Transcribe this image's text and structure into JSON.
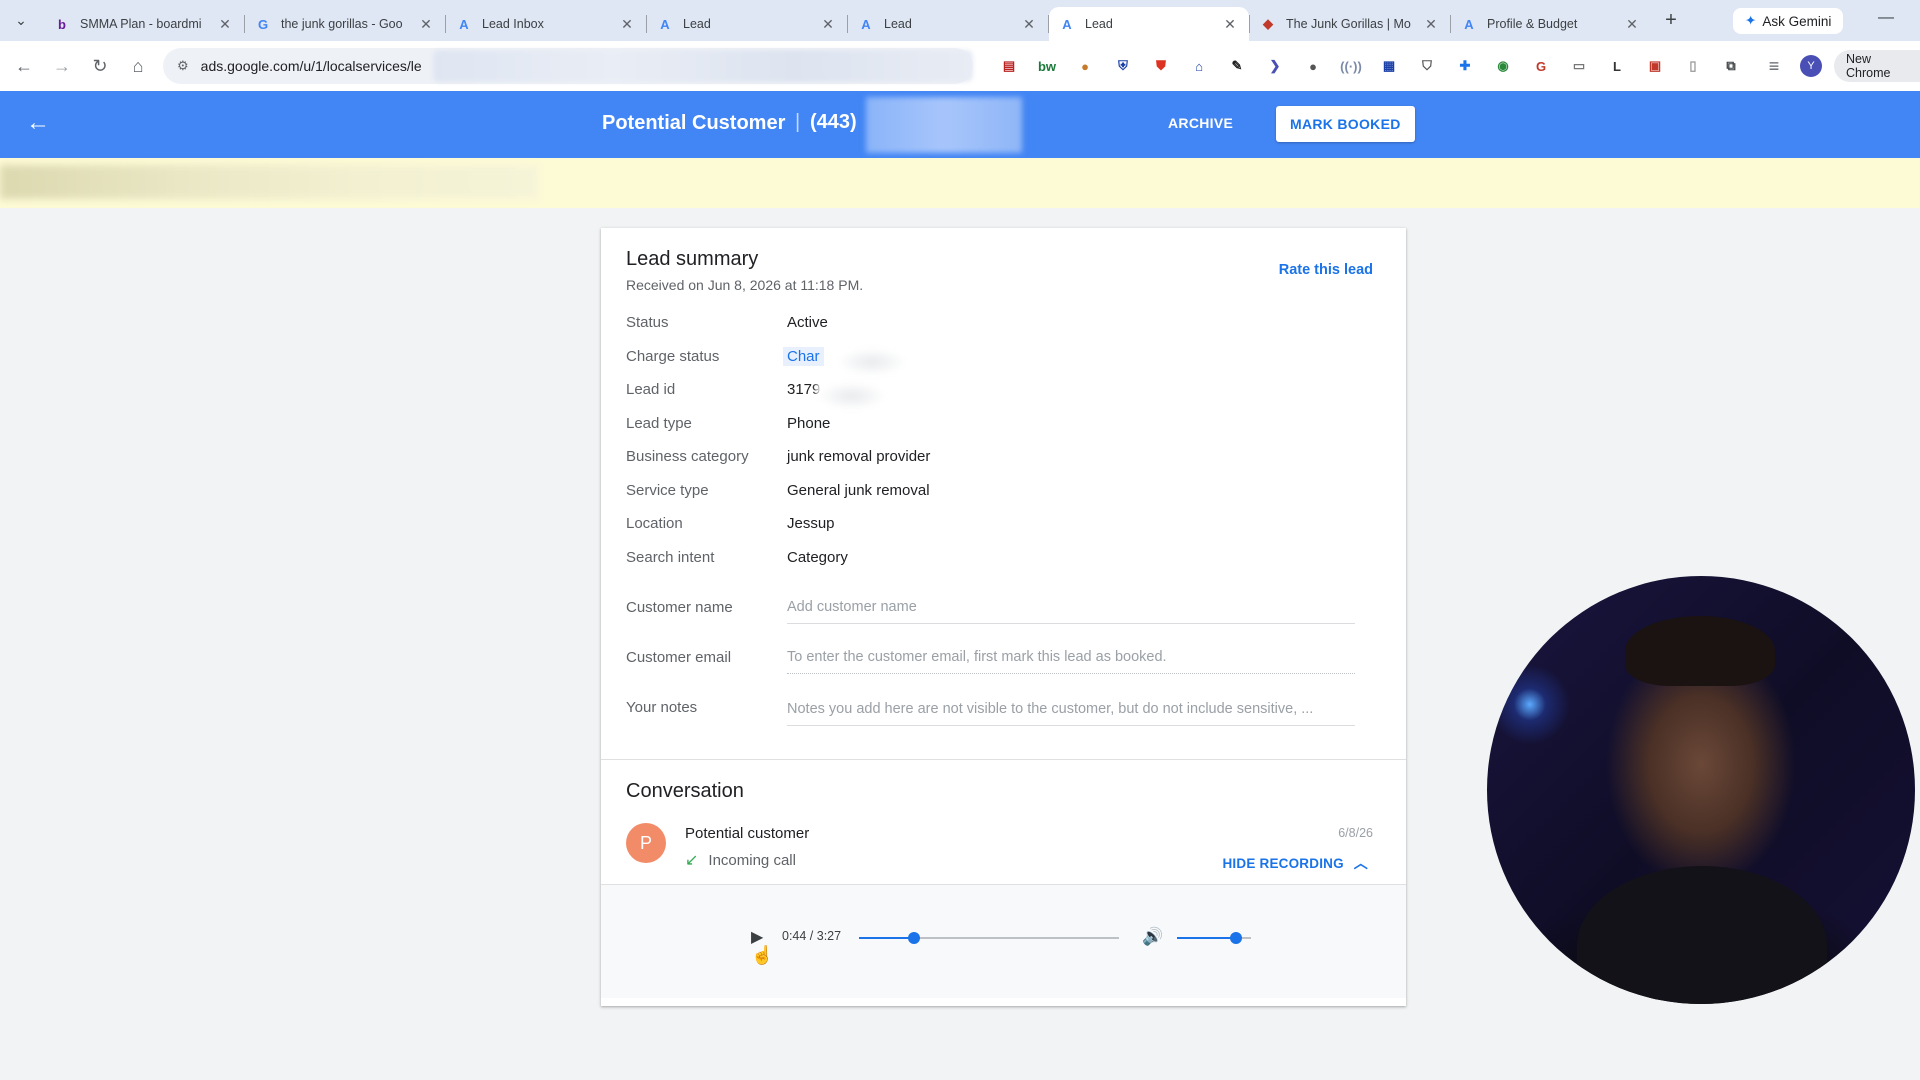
{
  "browser": {
    "tabs": [
      {
        "title": "SMMA Plan - boardmi",
        "icon": "b"
      },
      {
        "title": "the junk gorillas - Goo",
        "icon": "G"
      },
      {
        "title": "Lead Inbox",
        "icon": "A"
      },
      {
        "title": "Lead",
        "icon": "A"
      },
      {
        "title": "Lead",
        "icon": "A"
      },
      {
        "title": "Lead",
        "icon": "A"
      },
      {
        "title": "The Junk Gorillas | Mo",
        "icon": "◆"
      },
      {
        "title": "Profile & Budget",
        "icon": "A"
      }
    ],
    "active_tab": 5,
    "gemini_label": "Ask Gemini",
    "url": "ads.google.com/u/1/localservices/le",
    "profile_initial": "Y",
    "new_chrome_label": "New Chrome"
  },
  "header": {
    "title": "Potential Customer",
    "separator": "|",
    "phone_prefix": "(443)",
    "archive_label": "ARCHIVE",
    "mark_booked_label": "MARK BOOKED"
  },
  "lead_summary": {
    "title": "Lead summary",
    "received": "Received on Jun 8, 2026 at 11:18 PM.",
    "rate_label": "Rate this lead",
    "rows": [
      {
        "label": "Status",
        "value": "Active"
      },
      {
        "label": "Charge status",
        "value": "Char"
      },
      {
        "label": "Lead id",
        "value": "3179"
      },
      {
        "label": "Lead type",
        "value": "Phone"
      },
      {
        "label": "Business category",
        "value": "junk removal provider"
      },
      {
        "label": "Service type",
        "value": "General junk removal"
      },
      {
        "label": "Location",
        "value": "Jessup"
      },
      {
        "label": "Search intent",
        "value": "Category"
      }
    ],
    "customer_name_label": "Customer name",
    "customer_name_placeholder": "Add customer name",
    "customer_email_label": "Customer email",
    "customer_email_placeholder": "To enter the customer email, first mark this lead as booked.",
    "notes_label": "Your notes",
    "notes_placeholder": "Notes you add here are not visible to the customer, but do not include sensitive, ..."
  },
  "conversation": {
    "title": "Conversation",
    "avatar_initial": "P",
    "caller": "Potential customer",
    "call_type": "Incoming call",
    "date": "6/8/26",
    "hide_recording_label": "HIDE RECORDING",
    "player": {
      "time": "0:44 / 3:27",
      "progress": 0.213,
      "volume": 0.8
    }
  },
  "colors": {
    "brand_blue": "#4285f4",
    "link_blue": "#1a73e8",
    "banner_yellow": "#fdfbd6",
    "avatar_orange": "#f28b68"
  }
}
